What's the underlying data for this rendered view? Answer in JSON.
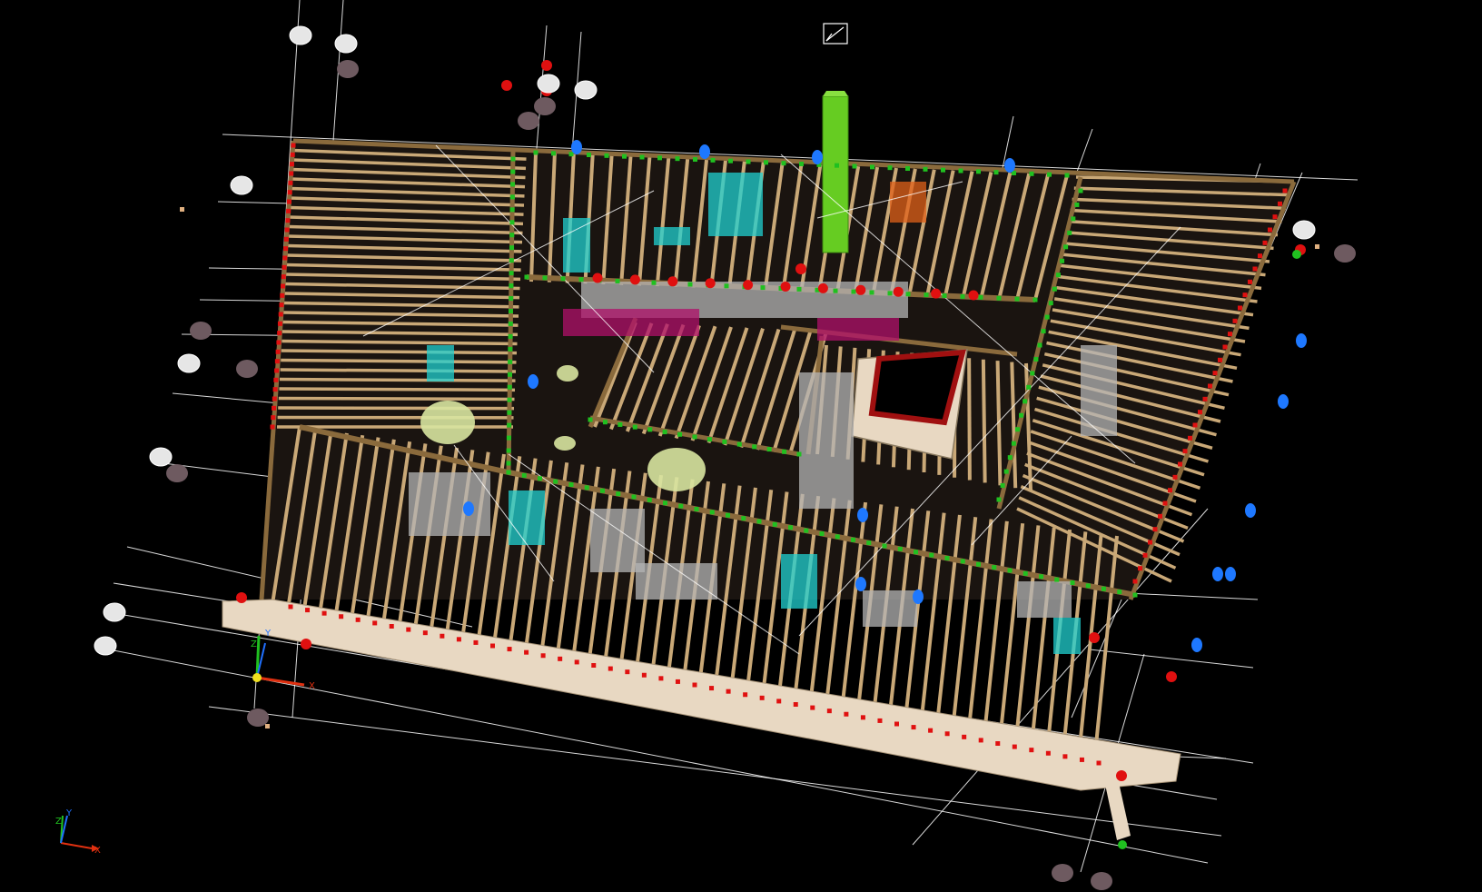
{
  "viewport": {
    "background": "#000000",
    "mode": "3d-perspective"
  },
  "colors": {
    "timber": "#c9a877",
    "timber_dark": "#8a6a3c",
    "board": "#e8d8c2",
    "guide_line": "#ffffff",
    "grid_bubble_light": "#e6e6e6",
    "grid_bubble_dark": "#6e5a60",
    "joint_green": "#20c020",
    "joint_red": "#e01010",
    "marker_blue": "#1e78ff",
    "chimney": "#66cc22",
    "pipe_cyan": "#20d0d0",
    "pipe_grey": "#b4b4b4",
    "accent_magenta": "#b0106a",
    "skylight_frame": "#a01010",
    "round_pad": "#d8e4a0"
  },
  "axes_local": {
    "x_label": "X",
    "y_label": "Y",
    "z_label": "Z"
  },
  "axes_world": {
    "x_label": "X",
    "y_label": "Y",
    "z_label": "Z"
  },
  "icons": {
    "view_cube": "view-cube-icon",
    "axis_triad": "axis-triad-icon"
  }
}
